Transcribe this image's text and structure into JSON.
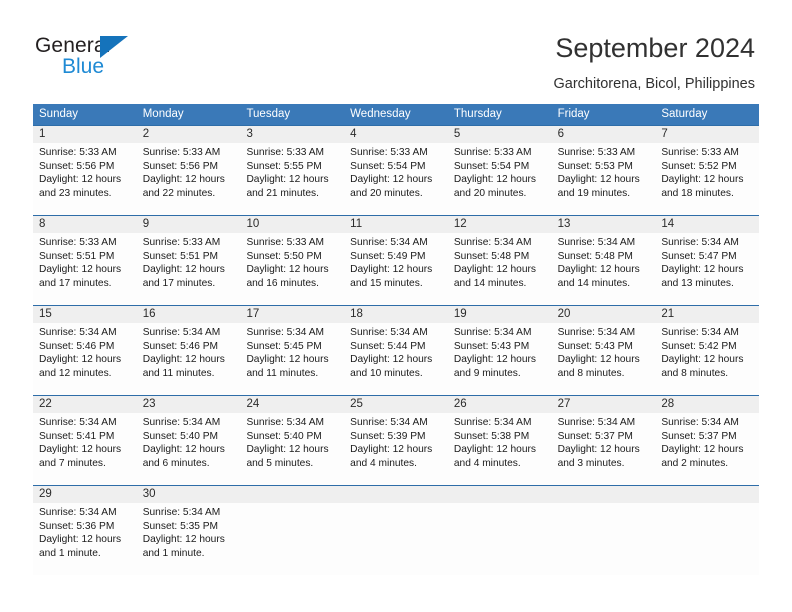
{
  "logo": {
    "text_top": "General",
    "text_bottom": "Blue",
    "color_dark": "#231f20",
    "color_blue": "#1f8ad4"
  },
  "header": {
    "title": "September 2024",
    "subtitle": "Garchitorena, Bicol, Philippines"
  },
  "theme": {
    "header_bg": "#3a79b8",
    "header_text": "#ffffff",
    "row_divider": "#2e6da8",
    "daynum_bg": "#efefef",
    "cell_bg": "#fdfdfd"
  },
  "calendar": {
    "weekdays": [
      "Sunday",
      "Monday",
      "Tuesday",
      "Wednesday",
      "Thursday",
      "Friday",
      "Saturday"
    ],
    "weeks": [
      {
        "numbers": [
          "1",
          "2",
          "3",
          "4",
          "5",
          "6",
          "7"
        ],
        "days": [
          {
            "sunrise": "Sunrise: 5:33 AM",
            "sunset": "Sunset: 5:56 PM",
            "daylight1": "Daylight: 12 hours",
            "daylight2": "and 23 minutes."
          },
          {
            "sunrise": "Sunrise: 5:33 AM",
            "sunset": "Sunset: 5:56 PM",
            "daylight1": "Daylight: 12 hours",
            "daylight2": "and 22 minutes."
          },
          {
            "sunrise": "Sunrise: 5:33 AM",
            "sunset": "Sunset: 5:55 PM",
            "daylight1": "Daylight: 12 hours",
            "daylight2": "and 21 minutes."
          },
          {
            "sunrise": "Sunrise: 5:33 AM",
            "sunset": "Sunset: 5:54 PM",
            "daylight1": "Daylight: 12 hours",
            "daylight2": "and 20 minutes."
          },
          {
            "sunrise": "Sunrise: 5:33 AM",
            "sunset": "Sunset: 5:54 PM",
            "daylight1": "Daylight: 12 hours",
            "daylight2": "and 20 minutes."
          },
          {
            "sunrise": "Sunrise: 5:33 AM",
            "sunset": "Sunset: 5:53 PM",
            "daylight1": "Daylight: 12 hours",
            "daylight2": "and 19 minutes."
          },
          {
            "sunrise": "Sunrise: 5:33 AM",
            "sunset": "Sunset: 5:52 PM",
            "daylight1": "Daylight: 12 hours",
            "daylight2": "and 18 minutes."
          }
        ]
      },
      {
        "numbers": [
          "8",
          "9",
          "10",
          "11",
          "12",
          "13",
          "14"
        ],
        "days": [
          {
            "sunrise": "Sunrise: 5:33 AM",
            "sunset": "Sunset: 5:51 PM",
            "daylight1": "Daylight: 12 hours",
            "daylight2": "and 17 minutes."
          },
          {
            "sunrise": "Sunrise: 5:33 AM",
            "sunset": "Sunset: 5:51 PM",
            "daylight1": "Daylight: 12 hours",
            "daylight2": "and 17 minutes."
          },
          {
            "sunrise": "Sunrise: 5:33 AM",
            "sunset": "Sunset: 5:50 PM",
            "daylight1": "Daylight: 12 hours",
            "daylight2": "and 16 minutes."
          },
          {
            "sunrise": "Sunrise: 5:34 AM",
            "sunset": "Sunset: 5:49 PM",
            "daylight1": "Daylight: 12 hours",
            "daylight2": "and 15 minutes."
          },
          {
            "sunrise": "Sunrise: 5:34 AM",
            "sunset": "Sunset: 5:48 PM",
            "daylight1": "Daylight: 12 hours",
            "daylight2": "and 14 minutes."
          },
          {
            "sunrise": "Sunrise: 5:34 AM",
            "sunset": "Sunset: 5:48 PM",
            "daylight1": "Daylight: 12 hours",
            "daylight2": "and 14 minutes."
          },
          {
            "sunrise": "Sunrise: 5:34 AM",
            "sunset": "Sunset: 5:47 PM",
            "daylight1": "Daylight: 12 hours",
            "daylight2": "and 13 minutes."
          }
        ]
      },
      {
        "numbers": [
          "15",
          "16",
          "17",
          "18",
          "19",
          "20",
          "21"
        ],
        "days": [
          {
            "sunrise": "Sunrise: 5:34 AM",
            "sunset": "Sunset: 5:46 PM",
            "daylight1": "Daylight: 12 hours",
            "daylight2": "and 12 minutes."
          },
          {
            "sunrise": "Sunrise: 5:34 AM",
            "sunset": "Sunset: 5:46 PM",
            "daylight1": "Daylight: 12 hours",
            "daylight2": "and 11 minutes."
          },
          {
            "sunrise": "Sunrise: 5:34 AM",
            "sunset": "Sunset: 5:45 PM",
            "daylight1": "Daylight: 12 hours",
            "daylight2": "and 11 minutes."
          },
          {
            "sunrise": "Sunrise: 5:34 AM",
            "sunset": "Sunset: 5:44 PM",
            "daylight1": "Daylight: 12 hours",
            "daylight2": "and 10 minutes."
          },
          {
            "sunrise": "Sunrise: 5:34 AM",
            "sunset": "Sunset: 5:43 PM",
            "daylight1": "Daylight: 12 hours",
            "daylight2": "and 9 minutes."
          },
          {
            "sunrise": "Sunrise: 5:34 AM",
            "sunset": "Sunset: 5:43 PM",
            "daylight1": "Daylight: 12 hours",
            "daylight2": "and 8 minutes."
          },
          {
            "sunrise": "Sunrise: 5:34 AM",
            "sunset": "Sunset: 5:42 PM",
            "daylight1": "Daylight: 12 hours",
            "daylight2": "and 8 minutes."
          }
        ]
      },
      {
        "numbers": [
          "22",
          "23",
          "24",
          "25",
          "26",
          "27",
          "28"
        ],
        "days": [
          {
            "sunrise": "Sunrise: 5:34 AM",
            "sunset": "Sunset: 5:41 PM",
            "daylight1": "Daylight: 12 hours",
            "daylight2": "and 7 minutes."
          },
          {
            "sunrise": "Sunrise: 5:34 AM",
            "sunset": "Sunset: 5:40 PM",
            "daylight1": "Daylight: 12 hours",
            "daylight2": "and 6 minutes."
          },
          {
            "sunrise": "Sunrise: 5:34 AM",
            "sunset": "Sunset: 5:40 PM",
            "daylight1": "Daylight: 12 hours",
            "daylight2": "and 5 minutes."
          },
          {
            "sunrise": "Sunrise: 5:34 AM",
            "sunset": "Sunset: 5:39 PM",
            "daylight1": "Daylight: 12 hours",
            "daylight2": "and 4 minutes."
          },
          {
            "sunrise": "Sunrise: 5:34 AM",
            "sunset": "Sunset: 5:38 PM",
            "daylight1": "Daylight: 12 hours",
            "daylight2": "and 4 minutes."
          },
          {
            "sunrise": "Sunrise: 5:34 AM",
            "sunset": "Sunset: 5:37 PM",
            "daylight1": "Daylight: 12 hours",
            "daylight2": "and 3 minutes."
          },
          {
            "sunrise": "Sunrise: 5:34 AM",
            "sunset": "Sunset: 5:37 PM",
            "daylight1": "Daylight: 12 hours",
            "daylight2": "and 2 minutes."
          }
        ]
      },
      {
        "numbers": [
          "29",
          "30",
          "",
          "",
          "",
          "",
          ""
        ],
        "days": [
          {
            "sunrise": "Sunrise: 5:34 AM",
            "sunset": "Sunset: 5:36 PM",
            "daylight1": "Daylight: 12 hours",
            "daylight2": "and 1 minute."
          },
          {
            "sunrise": "Sunrise: 5:34 AM",
            "sunset": "Sunset: 5:35 PM",
            "daylight1": "Daylight: 12 hours",
            "daylight2": "and 1 minute."
          },
          {
            "sunrise": "",
            "sunset": "",
            "daylight1": "",
            "daylight2": ""
          },
          {
            "sunrise": "",
            "sunset": "",
            "daylight1": "",
            "daylight2": ""
          },
          {
            "sunrise": "",
            "sunset": "",
            "daylight1": "",
            "daylight2": ""
          },
          {
            "sunrise": "",
            "sunset": "",
            "daylight1": "",
            "daylight2": ""
          },
          {
            "sunrise": "",
            "sunset": "",
            "daylight1": "",
            "daylight2": ""
          }
        ]
      }
    ]
  }
}
